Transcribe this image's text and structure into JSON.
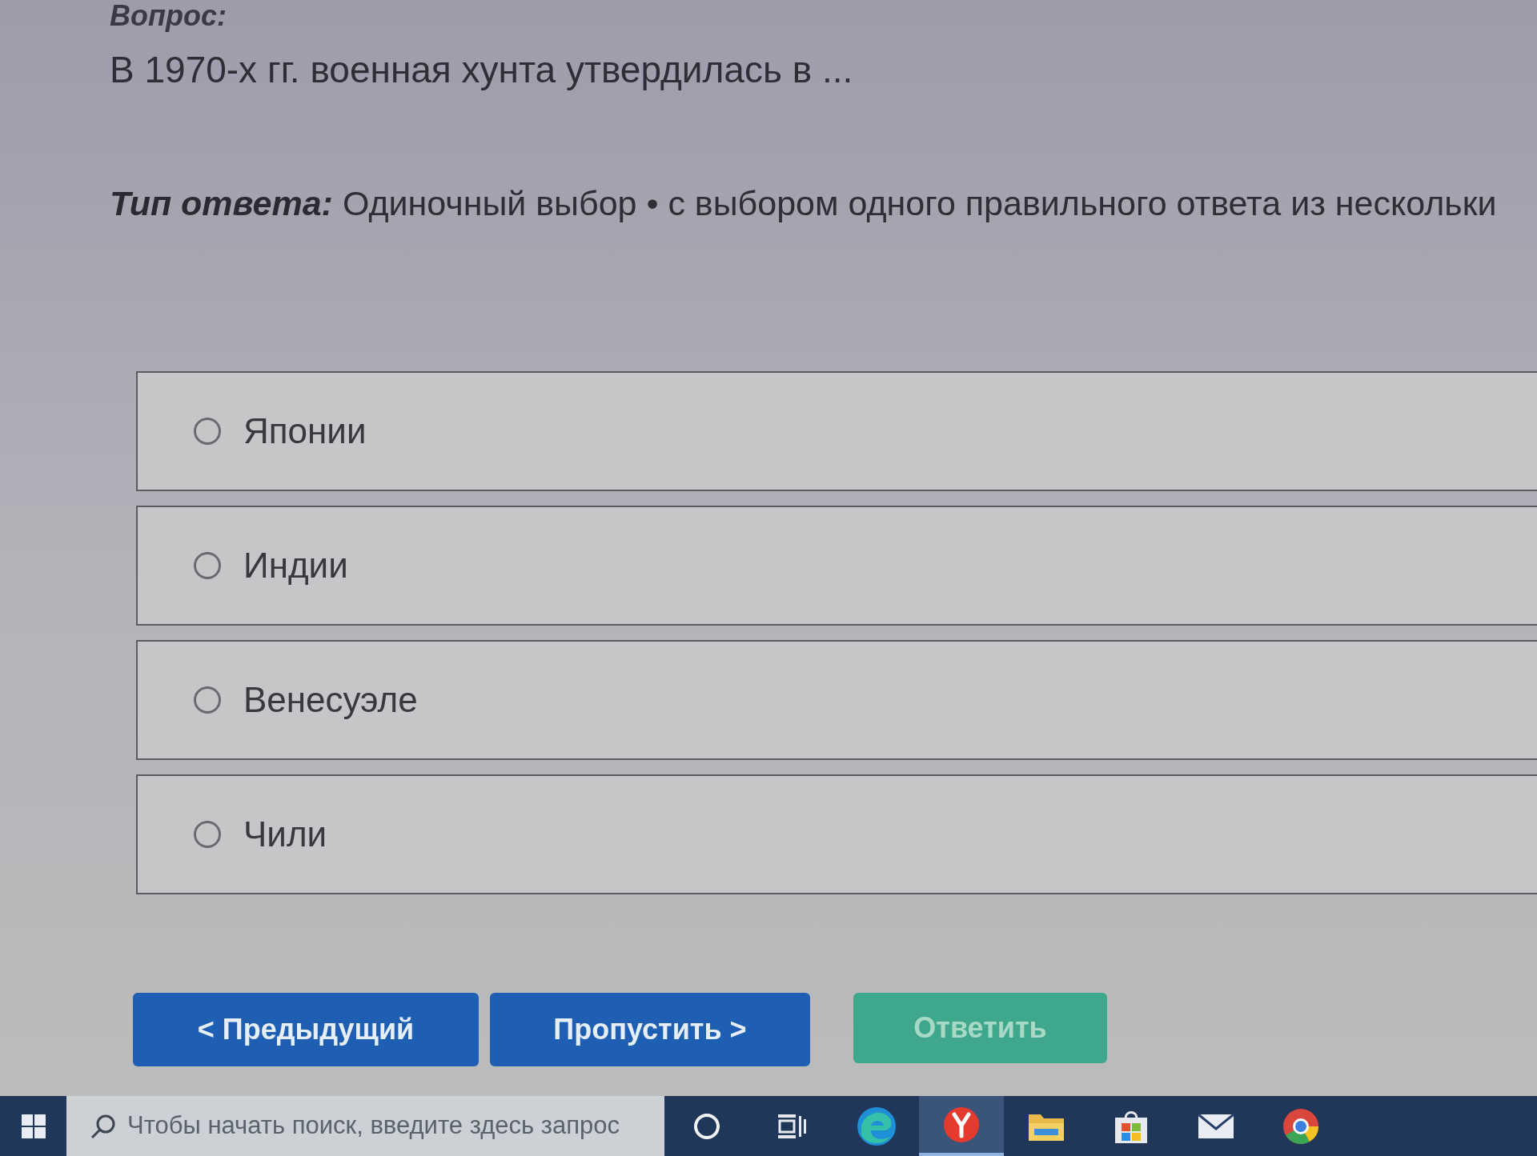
{
  "question": {
    "heading": "Вопрос:",
    "text": "В 1970-х гг. военная хунта утвердилась в ..."
  },
  "answer_type": {
    "label": "Тип ответа:",
    "value": "Одиночный выбор • с выбором одного правильного ответа из нескольки"
  },
  "options": [
    {
      "label": "Японии",
      "selected": false
    },
    {
      "label": "Индии",
      "selected": false
    },
    {
      "label": "Венесуэле",
      "selected": false
    },
    {
      "label": "Чили",
      "selected": false
    }
  ],
  "buttons": [
    {
      "label": "< Предыдущий",
      "disabled": false
    },
    {
      "label": "Пропустить >",
      "disabled": false
    },
    {
      "label": "Ответить",
      "disabled": true
    }
  ],
  "taskbar": {
    "search": {
      "placeholder": "Чтобы начать поиск, введите здесь запрос"
    },
    "apps": [
      {
        "kind": "ring",
        "active": false
      },
      {
        "kind": "task_view",
        "active": false
      },
      {
        "kind": "swirl",
        "active": false
      },
      {
        "kind": "y_logo",
        "active": true
      },
      {
        "kind": "folder",
        "active": false
      },
      {
        "kind": "bag",
        "active": false
      },
      {
        "kind": "envelope",
        "active": false
      },
      {
        "kind": "wheel",
        "active": false
      }
    ]
  }
}
